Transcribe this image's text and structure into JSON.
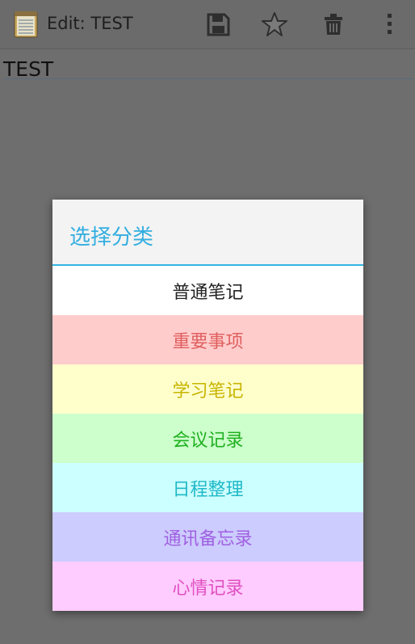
{
  "header": {
    "title": "Edit: TEST",
    "app_icon": "notepad-icon",
    "actions": {
      "save_icon": "save-icon",
      "favorite_icon": "star-icon",
      "delete_icon": "trash-icon",
      "more_icon": "overflow-menu-icon"
    }
  },
  "editor": {
    "text": "TEST"
  },
  "dialog": {
    "title": "选择分类",
    "accent_color": "#33b5e5",
    "options": [
      {
        "label": "普通笔记",
        "bg": "#ffffff",
        "fg": "#222222"
      },
      {
        "label": "重要事项",
        "bg": "#ffcccc",
        "fg": "#e06060"
      },
      {
        "label": "学习笔记",
        "bg": "#ffffcc",
        "fg": "#c8b400"
      },
      {
        "label": "会议记录",
        "bg": "#ccffcc",
        "fg": "#20b020"
      },
      {
        "label": "日程整理",
        "bg": "#ccffff",
        "fg": "#20b8c8"
      },
      {
        "label": "通讯备忘录",
        "bg": "#ccccff",
        "fg": "#a060e0"
      },
      {
        "label": "心情记录",
        "bg": "#ffccff",
        "fg": "#e050c0"
      }
    ]
  }
}
